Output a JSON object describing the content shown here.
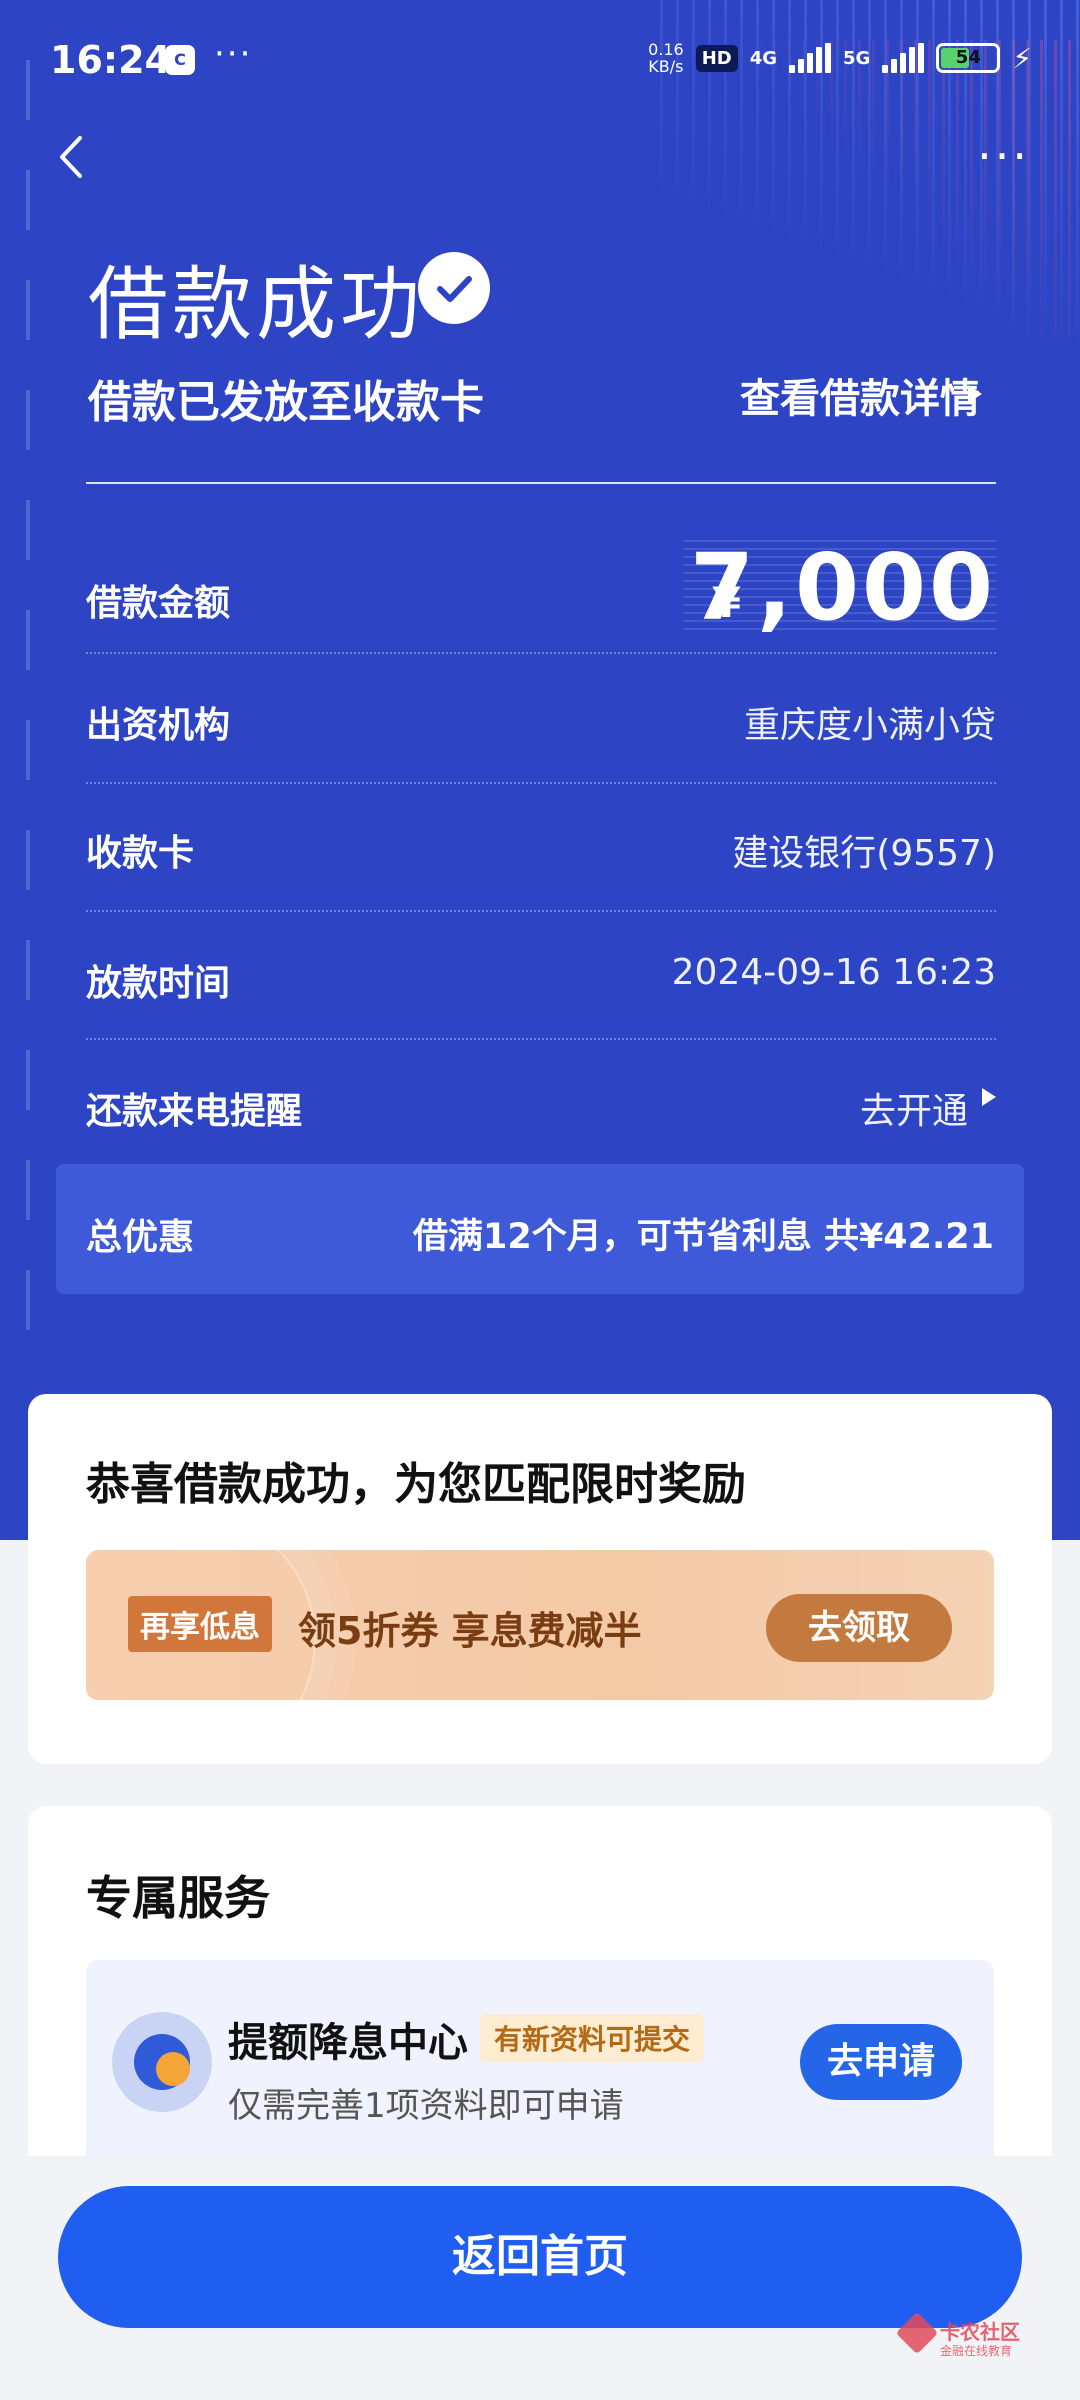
{
  "status_bar": {
    "time": "16:24",
    "app_icon": "C",
    "more": "···",
    "speed_top": "0.16",
    "speed_bottom": "KB/s",
    "hd": "HD",
    "net1": "4G",
    "net2": "5G",
    "battery": "54",
    "battery_level": 0.54
  },
  "header": {
    "back_icon": "chevron-left-icon",
    "more_icon": "more-dots-icon",
    "more_text": "···"
  },
  "hero": {
    "title": "借款成功",
    "subtitle": "借款已发放至收款卡",
    "detail_link": "查看借款详情"
  },
  "loan": {
    "amount_label": "借款金额",
    "currency": "¥",
    "amount": "7,000",
    "lender_label": "出资机构",
    "lender": "重庆度小满小贷",
    "card_label": "收款卡",
    "card": "建设银行(9557)",
    "time_label": "放款时间",
    "time": "2024-09-16 16:23",
    "reminder_label": "还款来电提醒",
    "reminder_action": "去开通"
  },
  "discount": {
    "label": "总优惠",
    "value": "借满12个月，可节省利息 共¥42.21"
  },
  "reward_card": {
    "heading": "恭喜借款成功，为您匹配限时奖励",
    "tag": "再享低息",
    "text": "领5折券 享息费减半",
    "button": "去领取"
  },
  "service_card": {
    "heading": "专属服务",
    "title": "提额降息中心",
    "badge": "有新资料可提交",
    "subtitle": "仅需完善1项资料即可申请",
    "button": "去申请"
  },
  "footer": {
    "home_button": "返回首页"
  },
  "watermark": {
    "text": "卡农社区",
    "sub": "金融在线教育"
  },
  "colors": {
    "hero_bg": "#2d44c5",
    "primary_button": "#1f5ef0",
    "promo_button": "#c47a3e"
  }
}
